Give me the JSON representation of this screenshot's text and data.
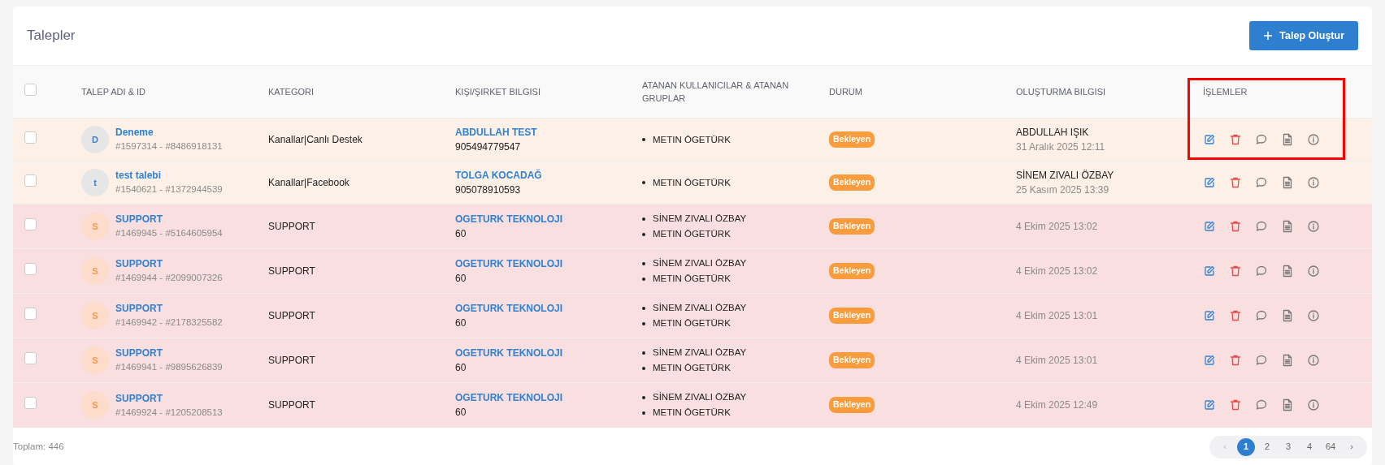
{
  "header": {
    "title": "Talepler",
    "create_button": "Talep Oluştur"
  },
  "table": {
    "select_all": {
      "checked": false
    },
    "columns": [
      "TALEP ADI & ID",
      "KATEGORI",
      "KIŞI/ŞIRKET BILGISI",
      "ATANAN KULLANICILAR & ATANAN GRUPLAR",
      "DURUM",
      "OLUŞTURMA BILGISI",
      "İŞLEMLER"
    ],
    "highlight_actions": true,
    "rows": [
      {
        "kind": "warning",
        "checked": false,
        "avatar": "D",
        "name": "Deneme",
        "ids": "#1597314 - #8486918131",
        "category": "Kanallar|Canlı Destek",
        "contact": "ABDULLAH TEST",
        "contact_detail": "905494779547",
        "assignees": [
          "METIN ÖGETÜRK"
        ],
        "status": {
          "kind": "pending",
          "label": "Bekleyen"
        },
        "creator": "ABDULLAH IŞIK",
        "created": "31 Aralık 2025 12:11"
      },
      {
        "kind": "warning",
        "checked": false,
        "avatar": "t",
        "name": "test talebi",
        "ids": "#1540621 - #1372944539",
        "category": "Kanallar|Facebook",
        "contact": "TOLGA KOCADAĞ",
        "contact_detail": "905078910593",
        "assignees": [
          "METIN ÖGETÜRK"
        ],
        "status": {
          "kind": "pending",
          "label": "Bekleyen"
        },
        "creator": "SİNEM ZIVALI ÖZBAY",
        "created": "25 Kasım 2025 13:39"
      },
      {
        "kind": "danger",
        "checked": false,
        "avatar": "S",
        "name": "SUPPORT",
        "ids": "#1469945 - #5164605954",
        "category": "SUPPORT",
        "contact": "OGETURK TEKNOLOJI",
        "contact_detail": "60",
        "assignees": [
          "SİNEM ZIVALI ÖZBAY",
          "METIN ÖGETÜRK"
        ],
        "status": {
          "kind": "pending",
          "label": "Bekleyen"
        },
        "created": "4 Ekim 2025 13:02"
      },
      {
        "kind": "danger",
        "checked": false,
        "avatar": "S",
        "name": "SUPPORT",
        "ids": "#1469944 - #2099007326",
        "category": "SUPPORT",
        "contact": "OGETURK TEKNOLOJI",
        "contact_detail": "60",
        "assignees": [
          "SİNEM ZIVALI ÖZBAY",
          "METIN ÖGETÜRK"
        ],
        "status": {
          "kind": "pending",
          "label": "Bekleyen"
        },
        "created": "4 Ekim 2025 13:02"
      },
      {
        "kind": "danger",
        "checked": false,
        "avatar": "S",
        "name": "SUPPORT",
        "ids": "#1469942 - #2178325582",
        "category": "SUPPORT",
        "contact": "OGETURK TEKNOLOJI",
        "contact_detail": "60",
        "assignees": [
          "SİNEM ZIVALI ÖZBAY",
          "METIN ÖGETÜRK"
        ],
        "status": {
          "kind": "pending",
          "label": "Bekleyen"
        },
        "created": "4 Ekim 2025 13:01"
      },
      {
        "kind": "danger",
        "checked": false,
        "avatar": "S",
        "name": "SUPPORT",
        "ids": "#1469941 - #9895626839",
        "category": "SUPPORT",
        "contact": "OGETURK TEKNOLOJI",
        "contact_detail": "60",
        "assignees": [
          "SİNEM ZIVALI ÖZBAY",
          "METIN ÖGETÜRK"
        ],
        "status": {
          "kind": "pending",
          "label": "Bekleyen"
        },
        "created": "4 Ekim 2025 13:01"
      },
      {
        "kind": "danger",
        "checked": false,
        "avatar": "S",
        "name": "SUPPORT",
        "ids": "#1469924 - #1205208513",
        "category": "SUPPORT",
        "contact": "OGETURK TEKNOLOJI",
        "contact_detail": "60",
        "assignees": [
          "SİNEM ZIVALI ÖZBAY",
          "METIN ÖGETÜRK"
        ],
        "status": {
          "kind": "pending",
          "label": "Bekleyen"
        },
        "created": "4 Ekim 2025 12:49"
      }
    ]
  },
  "footer": {
    "total": "Toplam: 446",
    "pagination": {
      "prev": {
        "label": "‹",
        "disabled": true
      },
      "pages": [
        {
          "label": "1",
          "selected": true
        },
        {
          "label": "2",
          "selected": false
        },
        {
          "label": "3",
          "selected": false
        },
        {
          "label": "4",
          "selected": false
        },
        {
          "label": "64",
          "selected": false
        }
      ],
      "next": {
        "label": "›",
        "disabled": false
      }
    }
  }
}
